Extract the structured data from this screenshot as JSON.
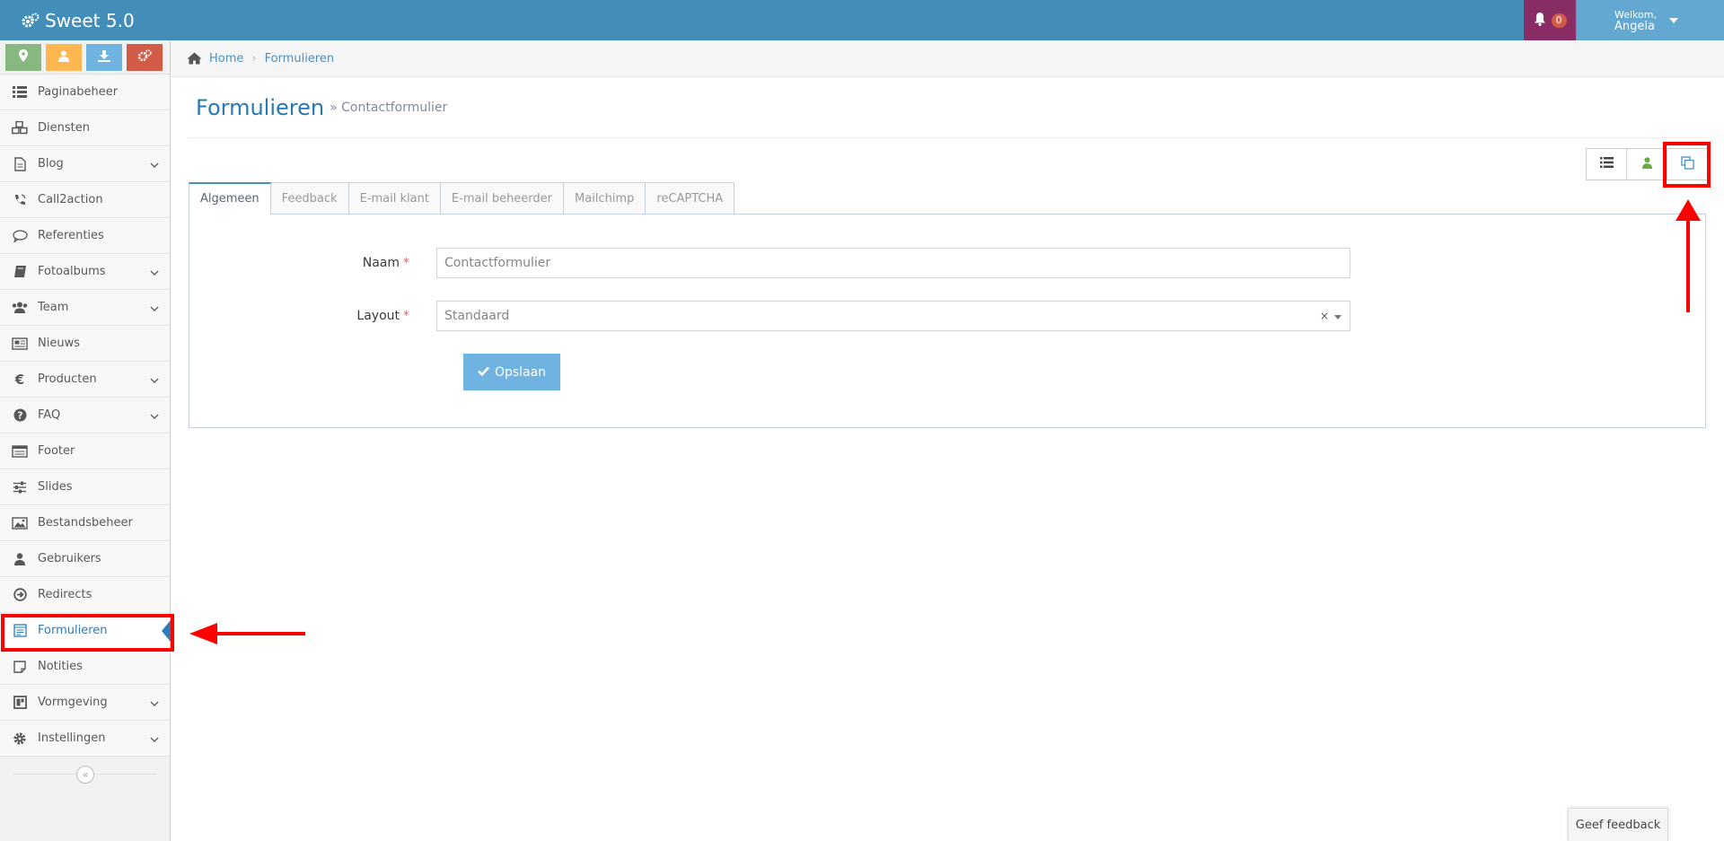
{
  "app": {
    "title": "Sweet 5.0"
  },
  "header": {
    "notifications_count": "0",
    "welcome_label": "Welkom,",
    "user_name": "Angela"
  },
  "shortcuts": [
    {
      "icon": "map-marker-icon",
      "color": "#87b87f"
    },
    {
      "icon": "user-icon",
      "color": "#ffb752"
    },
    {
      "icon": "download-icon",
      "color": "#6fb3e0"
    },
    {
      "icon": "cogs-icon",
      "color": "#d15b47"
    }
  ],
  "sidebar": {
    "items": [
      {
        "label": "Paginabeheer",
        "icon": "list-icon",
        "has_submenu": false
      },
      {
        "label": "Diensten",
        "icon": "cubes-icon",
        "has_submenu": false
      },
      {
        "label": "Blog",
        "icon": "document-icon",
        "has_submenu": true
      },
      {
        "label": "Call2action",
        "icon": "phone-icon",
        "has_submenu": false
      },
      {
        "label": "Referenties",
        "icon": "comment-icon",
        "has_submenu": false
      },
      {
        "label": "Fotoalbums",
        "icon": "book-icon",
        "has_submenu": true
      },
      {
        "label": "Team",
        "icon": "users-icon",
        "has_submenu": true
      },
      {
        "label": "Nieuws",
        "icon": "newspaper-icon",
        "has_submenu": false
      },
      {
        "label": "Producten",
        "icon": "euro-icon",
        "has_submenu": true
      },
      {
        "label": "FAQ",
        "icon": "question-icon",
        "has_submenu": true
      },
      {
        "label": "Footer",
        "icon": "footer-icon",
        "has_submenu": false
      },
      {
        "label": "Slides",
        "icon": "sliders-icon",
        "has_submenu": false
      },
      {
        "label": "Bestandsbeheer",
        "icon": "image-icon",
        "has_submenu": false
      },
      {
        "label": "Gebruikers",
        "icon": "user-icon",
        "has_submenu": false
      },
      {
        "label": "Redirects",
        "icon": "arrow-circle-icon",
        "has_submenu": false
      },
      {
        "label": "Formulieren",
        "icon": "form-icon",
        "has_submenu": false,
        "active": true
      },
      {
        "label": "Notities",
        "icon": "note-icon",
        "has_submenu": false
      },
      {
        "label": "Vormgeving",
        "icon": "layout-icon",
        "has_submenu": true
      },
      {
        "label": "Instellingen",
        "icon": "gear-icon",
        "has_submenu": true
      }
    ]
  },
  "breadcrumb": {
    "home": "Home",
    "current": "Formulieren"
  },
  "page": {
    "title": "Formulieren",
    "subtitle": "» Contactformulier"
  },
  "tabs": [
    "Algemeen",
    "Feedback",
    "E-mail klant",
    "E-mail beheerder",
    "Mailchimp",
    "reCAPTCHA"
  ],
  "form": {
    "name_label": "Naam",
    "name_value": "Contactformulier",
    "layout_label": "Layout",
    "layout_value": "Standaard",
    "required_mark": "*",
    "save_label": "Opslaan"
  },
  "feedback_button": "Geef feedback",
  "colors": {
    "navbar": "#438eb9",
    "accent": "#2b7dbc",
    "annotation": "#ff0000"
  }
}
